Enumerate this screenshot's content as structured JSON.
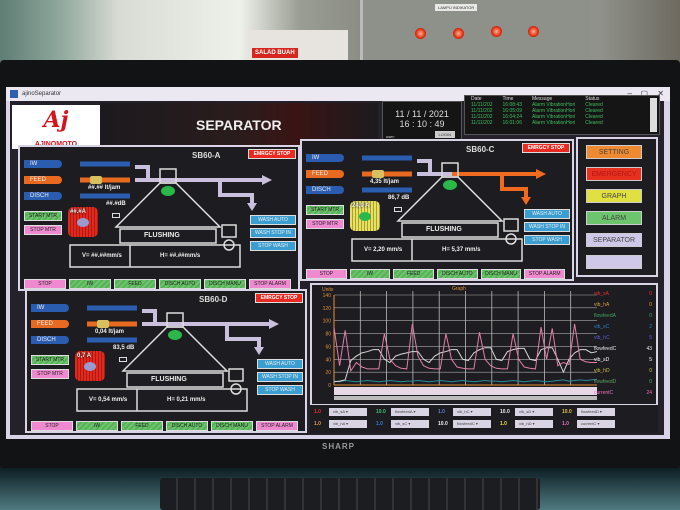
{
  "window": {
    "title": "ajinoSeparator",
    "min": "–",
    "max": "▢",
    "close": "✕"
  },
  "header": {
    "logo_mark": "Aj",
    "logo_name": "AJINOMOTO",
    "title": "SEPARATOR",
    "date": "11 / 11 / 2021",
    "time": "16 : 10 : 49",
    "user_label": "user:",
    "login_label": "LOGIN"
  },
  "alarm_table": {
    "columns": [
      "Date",
      "Time",
      "Message",
      "Status"
    ],
    "rows": [
      [
        "11/11/202",
        "16:08:43",
        "Alarm VibrationHori",
        "Cleared"
      ],
      [
        "11/11/202",
        "16:05:09",
        "Alarm VibrationHori",
        "Cleared"
      ],
      [
        "11/11/202",
        "16:04:24",
        "Alarm VibrationHori",
        "Cleared"
      ],
      [
        "11/11/202",
        "16:01:06",
        "Alarm VibrationHori",
        "Cleared"
      ]
    ]
  },
  "panels": [
    {
      "id": "a",
      "title": "SB60-A",
      "emergency": "EMRGCY STOP",
      "pipes": [
        "IW",
        "FEED",
        "DISCH"
      ],
      "flow": "##.## lt/jam",
      "current": "##.#A",
      "db": "##.#dB",
      "v": "V= ##.##mm/s",
      "h": "H= ##.##mm/s",
      "motor_color": "#e02a20",
      "state": "FLUSHING",
      "start": "START MTR",
      "stop_mtr": "STOP MTR",
      "wash": [
        "WASH AUTO",
        "WASH STOP IN",
        "STOP WASH"
      ],
      "bottom": [
        "STOP",
        "IW",
        "FEED",
        "DISCH AUTO",
        "DISCH MANU",
        "STOP ALARM"
      ]
    },
    {
      "id": "c",
      "title": "SB60-C",
      "emergency": "EMRGCY STOP",
      "pipes": [
        "IW",
        "FEED",
        "DISCH"
      ],
      "flow": "4,35  lt/jam",
      "current": "24,9  A",
      "db": "86,7  dB",
      "v": "V=  2,20   mm/s",
      "h": "H=  5,37   mm/s",
      "motor_color": "#e8e060",
      "state": "FLUSHING",
      "start": "START MTR",
      "stop_mtr": "STOP MTR",
      "wash": [
        "WASH AUTO",
        "WASH STOP IN",
        "STOP WASH"
      ],
      "bottom": [
        "STOP",
        "IW",
        "FEED",
        "DISCH AUTO",
        "DISCH MANU",
        "STOP ALARM"
      ]
    },
    {
      "id": "d",
      "title": "SB60-D",
      "emergency": "EMRGCY STOP",
      "pipes": [
        "IW",
        "FEED",
        "DISCH"
      ],
      "flow": "0,04  lt/jam",
      "current": "0,7  A",
      "db": "83,5  dB",
      "v": "V=  0,54   mm/s",
      "h": "H=  0,21   mm/s",
      "motor_color": "#e02a20",
      "state": "FLUSHING",
      "start": "START MTR",
      "stop_mtr": "STOP MTR",
      "wash": [
        "WASH AUTO",
        "WASH STOP IN",
        "STOP WASH"
      ],
      "bottom": [
        "STOP",
        "IW",
        "FEED",
        "DISCH AUTO",
        "DISCH MANU",
        "STOP ALARM"
      ]
    }
  ],
  "side_menu": [
    {
      "label": "SETTING",
      "color": "#f08a30"
    },
    {
      "label": "EMERGENCY",
      "color": "#e83020"
    },
    {
      "label": "GRAPH",
      "color": "#e0e040"
    },
    {
      "label": "ALARM",
      "color": "#6cc46c"
    },
    {
      "label": "SEPARATOR",
      "color": "#d0c8e8"
    },
    {
      "label": "",
      "color": "#d0c8e8"
    }
  ],
  "chart_data": {
    "type": "line",
    "title": "Graph",
    "ylabel": "Units",
    "ylim": [
      0,
      140
    ],
    "yticks": [
      0,
      20,
      40,
      60,
      80,
      100,
      120,
      140
    ],
    "grid": true,
    "legend": [
      {
        "name": "vib_sA",
        "value": "0",
        "color": "#f03030"
      },
      {
        "name": "vib_hA",
        "value": "0",
        "color": "#e0a040"
      },
      {
        "name": "flowfeedA",
        "value": "0",
        "color": "#40a060"
      },
      {
        "name": "vib_sC",
        "value": "2",
        "color": "#3080c0"
      },
      {
        "name": "vib_hC",
        "value": "5",
        "color": "#6060d0"
      },
      {
        "name": "flowfeedC",
        "value": "43",
        "color": "#e8e8e8"
      },
      {
        "name": "vib_sD",
        "value": "5",
        "color": "#ffffff"
      },
      {
        "name": "vib_hD",
        "value": "0",
        "color": "#d0c040"
      },
      {
        "name": "flowfeedD",
        "value": "0",
        "color": "#60a060"
      },
      {
        "name": "currentC",
        "value": "24",
        "color": "#f070c0"
      }
    ],
    "series": [
      {
        "name": "currentC",
        "color": "#e07fa8",
        "values": [
          90,
          30,
          85,
          22,
          35,
          28,
          25,
          25,
          25,
          80,
          40,
          30,
          26,
          25,
          95,
          45,
          30,
          26,
          25,
          25,
          80,
          40,
          28,
          26,
          25,
          25,
          82,
          40,
          30,
          26,
          25,
          25,
          80,
          40,
          28,
          26,
          25,
          90,
          40,
          88,
          30,
          35,
          32,
          95,
          40,
          36,
          35,
          35
        ]
      },
      {
        "name": "flowfeedC",
        "color": "#d8d8d8",
        "values": [
          5,
          6,
          8,
          38,
          45,
          50,
          52,
          55,
          55,
          40,
          35,
          45,
          48,
          50,
          52,
          52,
          40,
          35,
          45,
          50,
          52,
          55,
          55,
          40,
          38,
          50,
          55,
          58,
          58,
          40,
          38,
          52,
          55,
          57,
          57,
          40,
          38,
          55,
          58,
          58,
          40,
          20,
          40,
          50,
          55,
          55,
          50,
          52
        ]
      },
      {
        "name": "vib_sC",
        "color": "#2a8a9a",
        "values": [
          6,
          5,
          7,
          6,
          5,
          6,
          7,
          6,
          5,
          6,
          7,
          6,
          5,
          6,
          6,
          7,
          6,
          5,
          6,
          7,
          6,
          5,
          6,
          7,
          6,
          5,
          6,
          7,
          6,
          6,
          5,
          6,
          7,
          6,
          5,
          6,
          7,
          6,
          5,
          6,
          7,
          8,
          6,
          7,
          8,
          7,
          8,
          9
        ]
      },
      {
        "name": "vib_hA",
        "color": "#e09030",
        "values": [
          0,
          0,
          0,
          0,
          0,
          0,
          0,
          0,
          0,
          0,
          0,
          0,
          0,
          0,
          0,
          0,
          0,
          0,
          0,
          0,
          0,
          0,
          0,
          0,
          0,
          0,
          0,
          0,
          0,
          0,
          0,
          0,
          0,
          0,
          0,
          0,
          0,
          0,
          0,
          0,
          0,
          0,
          0,
          0,
          0,
          0,
          0,
          0
        ]
      }
    ]
  },
  "selectors": [
    [
      {
        "scale": "1.0",
        "color": "#f03030",
        "name": "vib_sA"
      },
      {
        "scale": "10.0",
        "color": "#40c070",
        "name": "flowfeedA"
      },
      {
        "scale": "1.0",
        "color": "#6080d0",
        "name": "vib_hC"
      },
      {
        "scale": "10.0",
        "color": "#eee",
        "name": "vib_sD"
      },
      {
        "scale": "10.0",
        "color": "#e0c040",
        "name": "flowfeedD"
      }
    ],
    [
      {
        "scale": "1.0",
        "color": "#e0a040",
        "name": "vib_hA"
      },
      {
        "scale": "1.0",
        "color": "#3080d0",
        "name": "vib_sC"
      },
      {
        "scale": "10.0",
        "color": "#eee",
        "name": "flowfeedC"
      },
      {
        "scale": "1.0",
        "color": "#e0e040",
        "name": "vib_hD"
      },
      {
        "scale": "1.0",
        "color": "#f070c0",
        "name": "currentC"
      }
    ]
  ],
  "monitor_brand": "SHARP",
  "poster_text": "SALAD BUAH"
}
